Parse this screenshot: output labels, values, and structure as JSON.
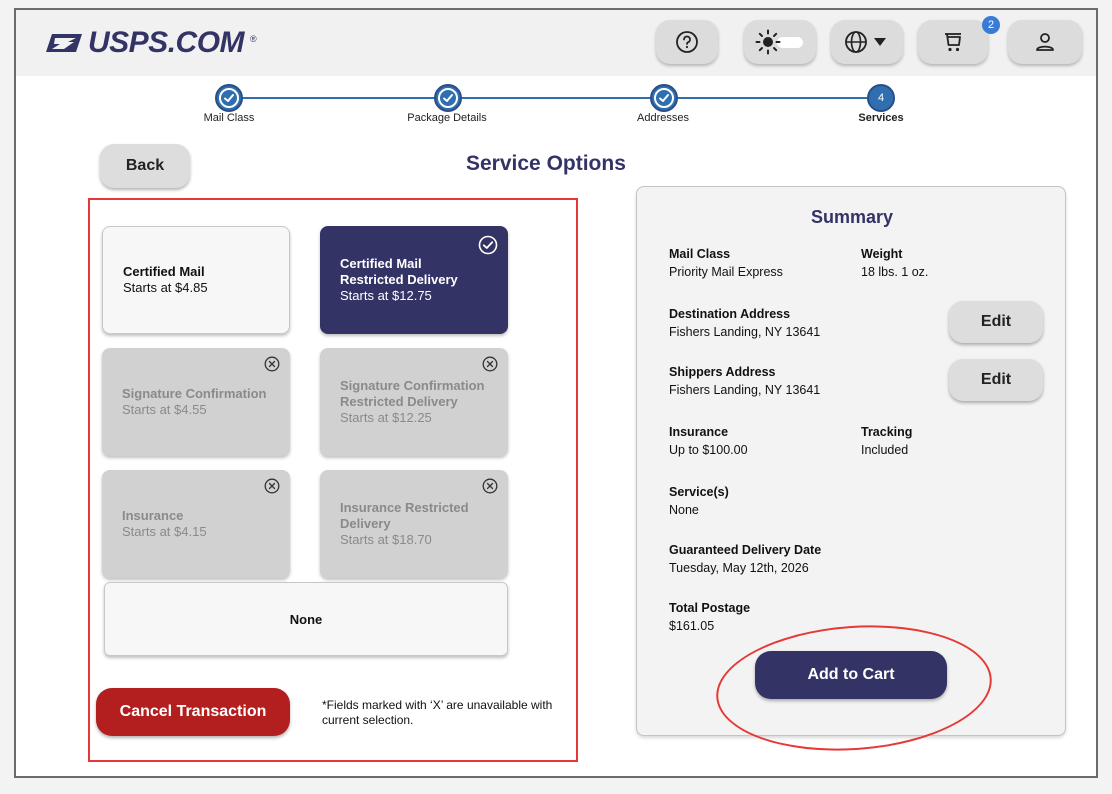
{
  "brand": {
    "logo_text": "USPS.COM",
    "reg_mark": "®"
  },
  "header": {
    "help_icon": "help-circle-icon",
    "theme_icon": "sun-toggle-icon",
    "language_icon": "globe-icon",
    "cart_icon": "cart-icon",
    "cart_count": "2",
    "account_icon": "user-icon"
  },
  "stepper": {
    "steps": [
      {
        "label": "Mail Class",
        "state": "complete"
      },
      {
        "label": "Package Details",
        "state": "complete"
      },
      {
        "label": "Addresses",
        "state": "complete"
      },
      {
        "label": "Services",
        "state": "current",
        "number": "4"
      }
    ]
  },
  "page": {
    "title": "Service Options",
    "back_label": "Back"
  },
  "options": [
    {
      "title": "Certified Mail",
      "price": "Starts at $4.85",
      "state": "available"
    },
    {
      "title": "Certified Mail Restricted Delivery",
      "price": "Starts at $12.75",
      "state": "selected"
    },
    {
      "title": "Signature Confirmation",
      "price": "Starts at $4.55",
      "state": "unavailable"
    },
    {
      "title": "Signature Confirmation Restricted Delivery",
      "price": "Starts at $12.25",
      "state": "unavailable"
    },
    {
      "title": "Insurance",
      "price": "Starts at $4.15",
      "state": "unavailable"
    },
    {
      "title": "Insurance Restricted Delivery",
      "price": "Starts at $18.70",
      "state": "unavailable"
    }
  ],
  "none_option": "None",
  "cancel_label": "Cancel Transaction",
  "note": "*Fields marked with ‘X’ are unavailable with current selection.",
  "summary": {
    "title": "Summary",
    "mail_class_label": "Mail Class",
    "mail_class_value": "Priority Mail Express",
    "weight_label": "Weight",
    "weight_value": "18 lbs. 1 oz.",
    "destination_label": "Destination Address",
    "destination_value": "Fishers Landing, NY 13641",
    "shippers_label": "Shippers Address",
    "shippers_value": "Fishers Landing, NY 13641",
    "edit_label": "Edit",
    "insurance_label": "Insurance",
    "insurance_value": "Up to $100.00",
    "tracking_label": "Tracking",
    "tracking_value": "Included",
    "services_label": "Service(s)",
    "services_value": "None",
    "delivery_label": "Guaranteed Delivery Date",
    "delivery_value": "Tuesday, May 12th, 2026",
    "postage_label": "Total Postage",
    "postage_value": "$161.05",
    "add_to_cart_label": "Add to Cart"
  },
  "colors": {
    "brand_navy": "#333366",
    "accent_blue": "#2f6fb0",
    "cancel_red": "#b31f1f",
    "highlight_red": "#e53935",
    "disabled_gray": "#d1d1d1"
  }
}
